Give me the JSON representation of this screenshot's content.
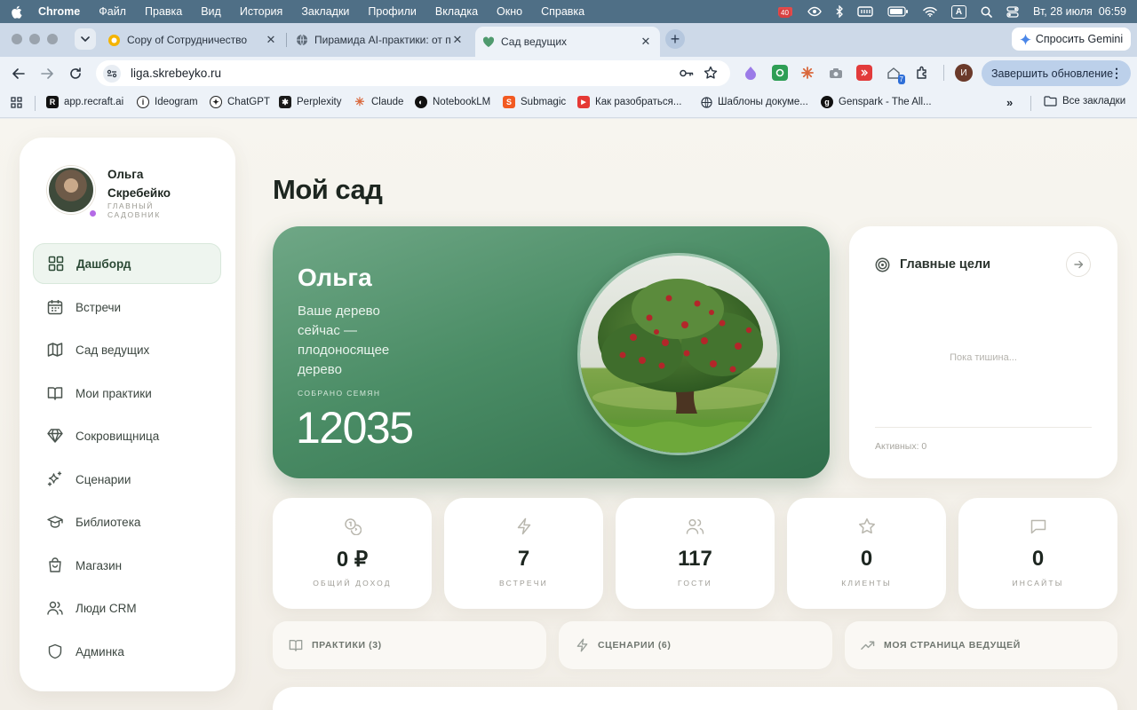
{
  "menubar": {
    "items": [
      "Chrome",
      "Файл",
      "Правка",
      "Вид",
      "История",
      "Закладки",
      "Профили",
      "Вкладка",
      "Окно",
      "Справка"
    ],
    "notification_count": "40",
    "input_indicator": "A",
    "datetime": "Вт, 28 июля  06:59"
  },
  "tabs": [
    {
      "label": "Copy of Сотрудничество"
    },
    {
      "label": "Пирамида AI-практики: от п"
    },
    {
      "label": "Сад ведущих"
    }
  ],
  "gemini_label": "Спросить Gemini",
  "omnibox": {
    "url": "liga.skrebeyko.ru"
  },
  "extension_badge": "7",
  "profile_initial": "И",
  "update_label": "Завершить обновление",
  "bookmarks": [
    "app.recraft.ai",
    "Ideogram",
    "ChatGPT",
    "Perplexity",
    "Claude",
    "NotebookLM",
    "Submagic",
    "Как разобраться...",
    "Шаблоны докуме...",
    "Genspark - The All..."
  ],
  "bookmarks_all": "Все закладки",
  "user": {
    "name": "Ольга Скребейко",
    "role": "Главный садовник"
  },
  "nav": [
    {
      "label": "Дашборд",
      "icon": "grid-icon",
      "active": true
    },
    {
      "label": "Встречи",
      "icon": "calendar-icon"
    },
    {
      "label": "Сад ведущих",
      "icon": "map-icon"
    },
    {
      "label": "Мои практики",
      "icon": "book-open-icon"
    },
    {
      "label": "Сокровищница",
      "icon": "gem-icon"
    },
    {
      "label": "Сценарии",
      "icon": "sparkles-icon"
    },
    {
      "label": "Библиотека",
      "icon": "graduation-cap-icon"
    },
    {
      "label": "Магазин",
      "icon": "shopping-bag-icon"
    },
    {
      "label": "Люди CRM",
      "icon": "users-icon"
    },
    {
      "label": "Админка",
      "icon": "shield-icon"
    }
  ],
  "page_title": "Мой сад",
  "hero": {
    "name": "Ольга",
    "status": "Ваше дерево сейчас — плодоносящее дерево",
    "seeds_label": "СОБРАНО СЕМЯН",
    "seeds": "12035"
  },
  "goals": {
    "title": "Главные цели",
    "empty": "Пока тишина...",
    "active": "Активных: 0"
  },
  "stats": [
    {
      "value": "0 ₽",
      "label": "ОБЩИЙ ДОХОД",
      "icon": "coins-icon"
    },
    {
      "value": "7",
      "label": "ВСТРЕЧИ",
      "icon": "lightning-icon"
    },
    {
      "value": "117",
      "label": "ГОСТИ",
      "icon": "users-icon"
    },
    {
      "value": "0",
      "label": "КЛИЕНТЫ",
      "icon": "star-icon"
    },
    {
      "value": "0",
      "label": "ИНСАЙТЫ",
      "icon": "message-icon"
    }
  ],
  "links": [
    {
      "label": "ПРАКТИКИ (3)",
      "icon": "book-open-icon"
    },
    {
      "label": "СЦЕНАРИИ (6)",
      "icon": "lightning-icon"
    },
    {
      "label": "МОЯ СТРАНИЦА ВЕДУЩЕЙ",
      "icon": "trending-up-icon"
    }
  ],
  "colors": {
    "accent_green": "#4b8d66",
    "active_nav_bg": "#eef5ef",
    "status_dot": "#b46ae6"
  }
}
